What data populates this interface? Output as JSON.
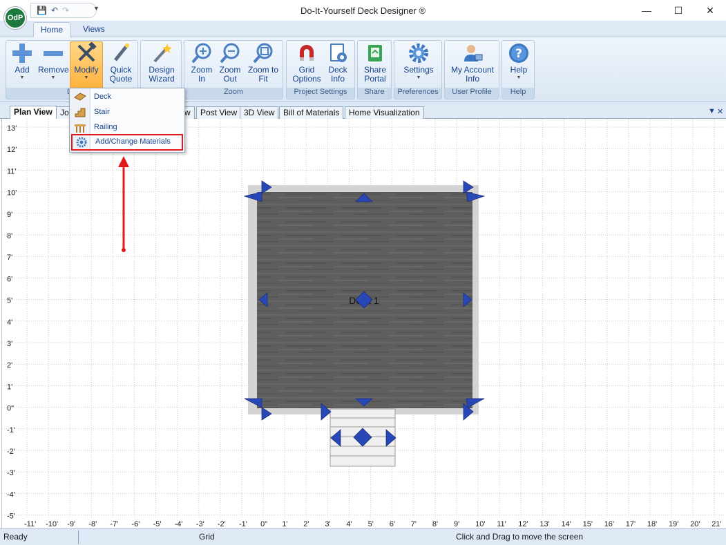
{
  "window": {
    "title": "Do-It-Yourself Deck Designer ®",
    "logo_text": "OdP",
    "minimize_glyph": "—",
    "maximize_glyph": "☐",
    "close_glyph": "✕"
  },
  "ribbon_tabs": [
    {
      "label": "Home",
      "active": true
    },
    {
      "label": "Views",
      "active": false
    }
  ],
  "ribbon": {
    "add": "Add",
    "remove": "Remove",
    "modify": "Modify",
    "quick_quote_1": "Quick",
    "quick_quote_2": "Quote",
    "design_wizard_1": "Design",
    "design_wizard_2": "Wizard",
    "zoom_in_1": "Zoom",
    "zoom_in_2": "In",
    "zoom_out_1": "Zoom",
    "zoom_out_2": "Out",
    "zoom_fit_1": "Zoom to",
    "zoom_fit_2": "Fit",
    "grid_options_1": "Grid",
    "grid_options_2": "Options",
    "deck_info_1": "Deck",
    "deck_info_2": "Info",
    "share_portal_1": "Share",
    "share_portal_2": "Portal",
    "settings": "Settings",
    "my_account_1": "My Account",
    "my_account_2": "Info",
    "help": "Help",
    "group_design": "De",
    "group_zoom": "Zoom",
    "group_project": "Project Settings",
    "group_share": "Share",
    "group_prefs": "Preferences",
    "group_profile": "User Profile",
    "group_help": "Help"
  },
  "modify_menu": [
    {
      "label": "Deck",
      "icon": "deck-icon"
    },
    {
      "label": "Stair",
      "icon": "stair-icon"
    },
    {
      "label": "Railing",
      "icon": "railing-icon"
    },
    {
      "label": "Add/Change Materials",
      "icon": "gear-icon",
      "highlighted": true
    }
  ],
  "doc_tabs": [
    {
      "label": "Plan View",
      "active": true
    },
    {
      "label": "Joi",
      "active": false
    },
    {
      "label": "w",
      "active": false
    },
    {
      "label": "Post View",
      "active": false
    },
    {
      "label": "3D View",
      "active": false
    },
    {
      "label": "Bill of Materials",
      "active": false
    },
    {
      "label": "Home Visualization",
      "active": false
    }
  ],
  "canvas": {
    "y_labels": [
      "13'",
      "12'",
      "11'",
      "10'",
      "9'",
      "8'",
      "7'",
      "6'",
      "5'",
      "4'",
      "3'",
      "2'",
      "1'",
      "0\"",
      "-1'",
      "-2'",
      "-3'",
      "-4'",
      "-5'"
    ],
    "x_labels": [
      "-11'",
      "-10'",
      "-9'",
      "-8'",
      "-7'",
      "-6'",
      "-5'",
      "-4'",
      "-3'",
      "-2'",
      "-1'",
      "0\"",
      "1'",
      "2'",
      "3'",
      "4'",
      "5'",
      "6'",
      "7'",
      "8'",
      "9'",
      "10'",
      "11'",
      "12'",
      "13'",
      "14'",
      "15'",
      "16'",
      "17'",
      "18'",
      "19'",
      "20'",
      "21'"
    ],
    "deck_label": "Deck 1",
    "deck_color": "#5e5e5e",
    "rim_color": "#d4d4d4",
    "handle_color": "#2848b8",
    "arrow_color": "#e01b1b"
  },
  "status": {
    "ready": "Ready",
    "grid": "Grid",
    "hint": "Click and Drag to move the screen"
  }
}
